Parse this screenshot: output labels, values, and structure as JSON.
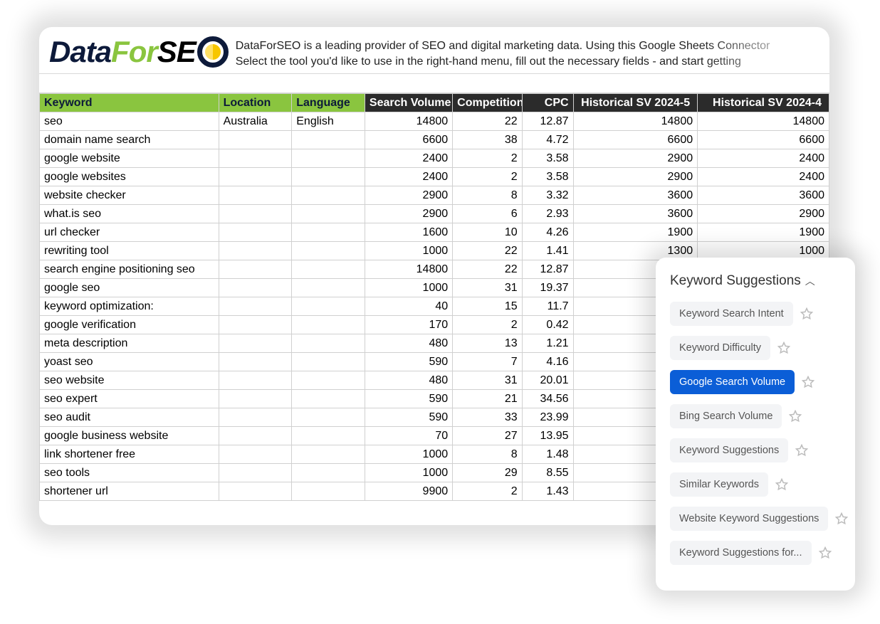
{
  "logo": {
    "p1": "Data",
    "p2": "For",
    "p3": "SE"
  },
  "intro": {
    "line1": "DataForSEO is a leading provider of SEO and digital marketing data. Using this Google Sheets Connector",
    "line2": "Select the tool you'd like to use in the right-hand menu, fill out the necessary fields - and start getting"
  },
  "columns": {
    "keyword": "Keyword",
    "location": "Location",
    "language": "Language",
    "search_volume": "Search Volume",
    "competition": "Competition",
    "cpc": "CPC",
    "hist1": "Historical SV 2024-5",
    "hist2": "Historical SV 2024-4"
  },
  "rows": [
    {
      "keyword": "seo",
      "location": "Australia",
      "language": "English",
      "sv": "14800",
      "comp": "22",
      "cpc": "12.87",
      "h1": "14800",
      "h2": "14800"
    },
    {
      "keyword": "domain name search",
      "location": "",
      "language": "",
      "sv": "6600",
      "comp": "38",
      "cpc": "4.72",
      "h1": "6600",
      "h2": "6600"
    },
    {
      "keyword": "google website",
      "location": "",
      "language": "",
      "sv": "2400",
      "comp": "2",
      "cpc": "3.58",
      "h1": "2900",
      "h2": "2400"
    },
    {
      "keyword": "google websites",
      "location": "",
      "language": "",
      "sv": "2400",
      "comp": "2",
      "cpc": "3.58",
      "h1": "2900",
      "h2": "2400"
    },
    {
      "keyword": "website checker",
      "location": "",
      "language": "",
      "sv": "2900",
      "comp": "8",
      "cpc": "3.32",
      "h1": "3600",
      "h2": "3600"
    },
    {
      "keyword": "what.is seo",
      "location": "",
      "language": "",
      "sv": "2900",
      "comp": "6",
      "cpc": "2.93",
      "h1": "3600",
      "h2": "2900"
    },
    {
      "keyword": "url checker",
      "location": "",
      "language": "",
      "sv": "1600",
      "comp": "10",
      "cpc": "4.26",
      "h1": "1900",
      "h2": "1900"
    },
    {
      "keyword": "rewriting tool",
      "location": "",
      "language": "",
      "sv": "1000",
      "comp": "22",
      "cpc": "1.41",
      "h1": "1300",
      "h2": "1000"
    },
    {
      "keyword": "search engine positioning seo",
      "location": "",
      "language": "",
      "sv": "14800",
      "comp": "22",
      "cpc": "12.87",
      "h1": "",
      "h2": ""
    },
    {
      "keyword": "google seo",
      "location": "",
      "language": "",
      "sv": "1000",
      "comp": "31",
      "cpc": "19.37",
      "h1": "",
      "h2": ""
    },
    {
      "keyword": "keyword optimization:",
      "location": "",
      "language": "",
      "sv": "40",
      "comp": "15",
      "cpc": "11.7",
      "h1": "",
      "h2": ""
    },
    {
      "keyword": "google verification",
      "location": "",
      "language": "",
      "sv": "170",
      "comp": "2",
      "cpc": "0.42",
      "h1": "",
      "h2": ""
    },
    {
      "keyword": "meta description",
      "location": "",
      "language": "",
      "sv": "480",
      "comp": "13",
      "cpc": "1.21",
      "h1": "",
      "h2": ""
    },
    {
      "keyword": "yoast seo",
      "location": "",
      "language": "",
      "sv": "590",
      "comp": "7",
      "cpc": "4.16",
      "h1": "",
      "h2": ""
    },
    {
      "keyword": "seo website",
      "location": "",
      "language": "",
      "sv": "480",
      "comp": "31",
      "cpc": "20.01",
      "h1": "",
      "h2": ""
    },
    {
      "keyword": "seo expert",
      "location": "",
      "language": "",
      "sv": "590",
      "comp": "21",
      "cpc": "34.56",
      "h1": "",
      "h2": ""
    },
    {
      "keyword": "seo audit",
      "location": "",
      "language": "",
      "sv": "590",
      "comp": "33",
      "cpc": "23.99",
      "h1": "",
      "h2": ""
    },
    {
      "keyword": "google business website",
      "location": "",
      "language": "",
      "sv": "70",
      "comp": "27",
      "cpc": "13.95",
      "h1": "",
      "h2": ""
    },
    {
      "keyword": "link shortener free",
      "location": "",
      "language": "",
      "sv": "1000",
      "comp": "8",
      "cpc": "1.48",
      "h1": "",
      "h2": ""
    },
    {
      "keyword": "seo tools",
      "location": "",
      "language": "",
      "sv": "1000",
      "comp": "29",
      "cpc": "8.55",
      "h1": "",
      "h2": ""
    },
    {
      "keyword": "shortener url",
      "location": "",
      "language": "",
      "sv": "9900",
      "comp": "2",
      "cpc": "1.43",
      "h1": "",
      "h2": ""
    }
  ],
  "panel": {
    "title": "Keyword Suggestions",
    "items": [
      {
        "label": "Keyword Search Intent",
        "active": false
      },
      {
        "label": "Keyword Difficulty",
        "active": false
      },
      {
        "label": "Google Search Volume",
        "active": true
      },
      {
        "label": "Bing Search Volume",
        "active": false
      },
      {
        "label": "Keyword Suggestions",
        "active": false
      },
      {
        "label": "Similar Keywords",
        "active": false
      },
      {
        "label": "Website Keyword Suggestions",
        "active": false
      },
      {
        "label": "Keyword Suggestions for...",
        "active": false
      }
    ]
  }
}
